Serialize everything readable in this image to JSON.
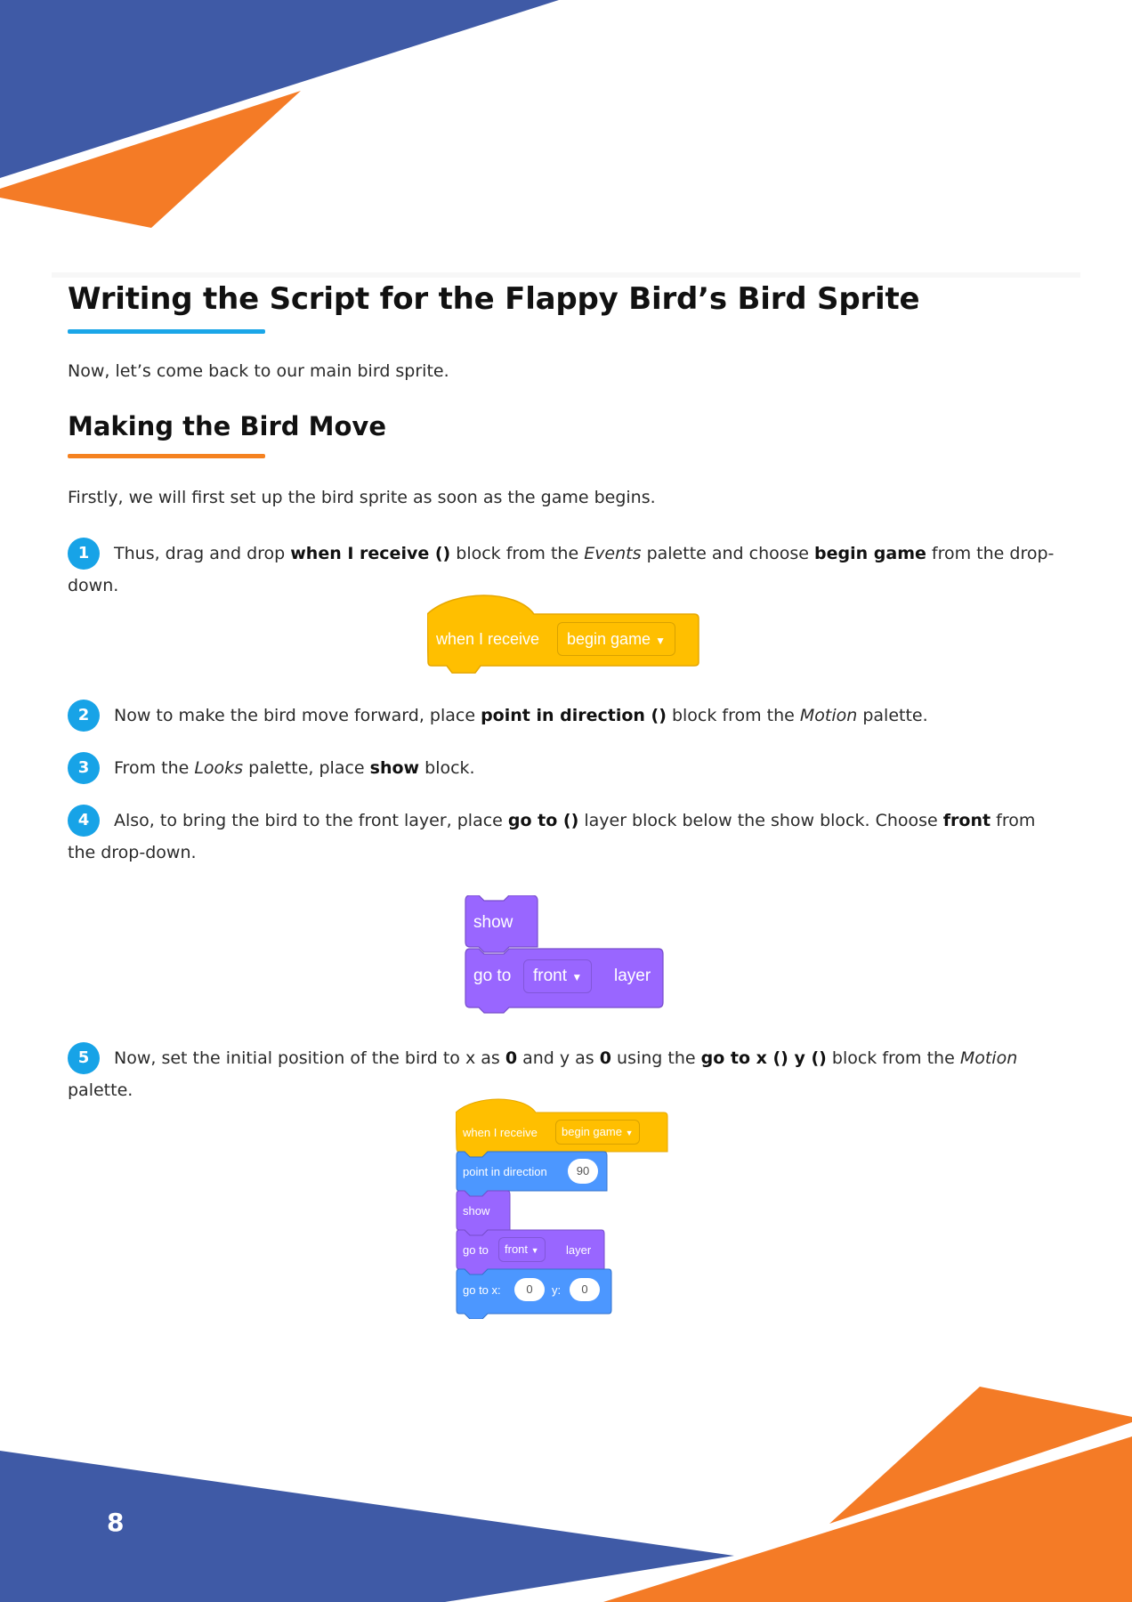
{
  "colors": {
    "blue_deco": "#3f5aa6",
    "orange_deco": "#f47b26",
    "title_rule": "#1aa6e8",
    "section_rule": "#f58220",
    "badge": "#17a3e7",
    "events": "#ffbf00",
    "looks": "#9966ff",
    "motion": "#4c97ff"
  },
  "title": "Writing the Script for the Flappy Bird’s Bird Sprite",
  "intro": "Now, let’s come back to our main bird sprite.",
  "section": "Making the Bird Move",
  "lead": "Firstly, we will first set up the bird sprite as soon as the game begins.",
  "steps": [
    {
      "num": "1",
      "parts": [
        "Thus, drag and drop ",
        "when I receive ()",
        " block from the ",
        "Events",
        " palette and choose ",
        "begin game",
        " from the drop-down."
      ]
    },
    {
      "num": "2",
      "parts": [
        "Now to make the bird move forward, place ",
        "point in direction ()",
        " block from the ",
        "Motion",
        " palette."
      ]
    },
    {
      "num": "3",
      "parts": [
        "From the ",
        "Looks",
        " palette, place ",
        "show",
        " block."
      ]
    },
    {
      "num": "4",
      "parts": [
        "Also, to bring the bird to the front layer, place ",
        "go to ()",
        " layer block below the show block. Choose ",
        "front",
        " from the drop-down."
      ]
    },
    {
      "num": "5",
      "parts": [
        "Now, set the initial position of the bird to x as ",
        "0",
        " and y as ",
        "0",
        " using the ",
        "go to x () y ()",
        " block from the ",
        "Motion",
        " palette."
      ]
    }
  ],
  "blocks": {
    "receive_label": "when I receive",
    "receive_option": "begin game",
    "show_label": "show",
    "goto_label": "go to",
    "goto_option": "front",
    "layer_label": "layer",
    "direction_label": "point in direction",
    "direction_value": "90",
    "gotoxy_label": "go to x:",
    "gotoxy_y_label": "y:",
    "x_value": "0",
    "y_value": "0"
  },
  "page_number": "8"
}
